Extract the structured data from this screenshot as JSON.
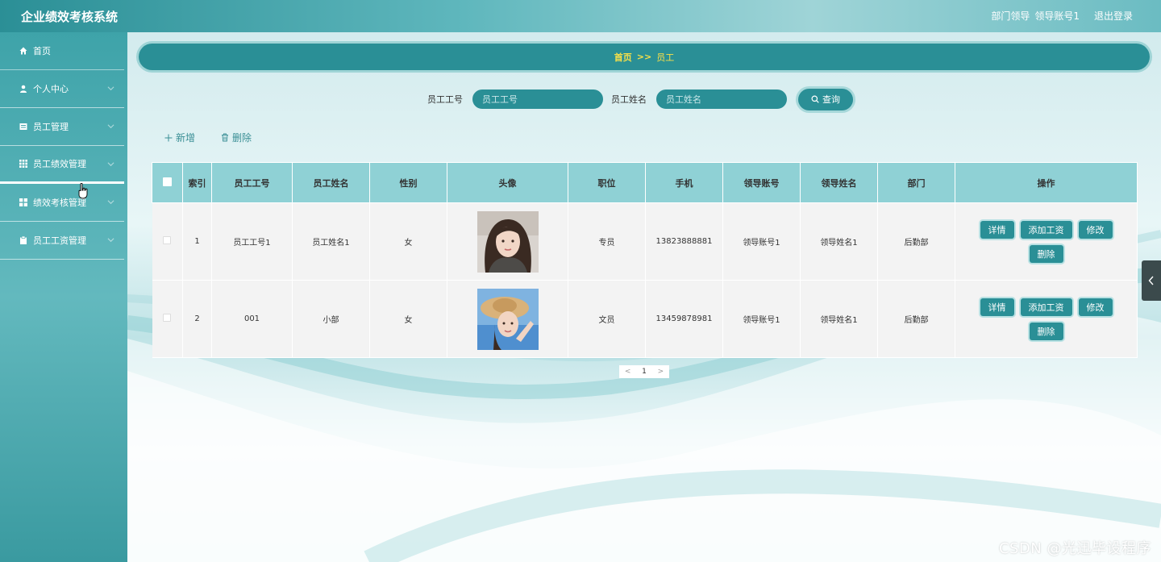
{
  "header": {
    "app_title": "企业绩效考核系统",
    "role": "部门领导",
    "username": "领导账号1",
    "logout": "退出登录"
  },
  "sidebar": {
    "items": [
      {
        "label": "首页",
        "icon": "home-icon"
      },
      {
        "label": "个人中心",
        "icon": "user-icon"
      },
      {
        "label": "员工管理",
        "icon": "list-icon"
      },
      {
        "label": "员工绩效管理",
        "icon": "grid-icon"
      },
      {
        "label": "绩效考核管理",
        "icon": "grid-icon"
      },
      {
        "label": "员工工资管理",
        "icon": "clipboard-icon"
      }
    ]
  },
  "breadcrumb": {
    "home": "首页",
    "separator": ">>",
    "current": "员工"
  },
  "search": {
    "emp_no_label": "员工工号",
    "emp_no_placeholder": "员工工号",
    "emp_name_label": "员工姓名",
    "emp_name_placeholder": "员工姓名",
    "query_label": "查询"
  },
  "actions": {
    "add": "新增",
    "delete": "删除"
  },
  "table": {
    "columns": [
      "索引",
      "员工工号",
      "员工姓名",
      "性别",
      "头像",
      "职位",
      "手机",
      "领导账号",
      "领导姓名",
      "部门",
      "操作"
    ],
    "rows": [
      {
        "index": "1",
        "emp_no": "员工工号1",
        "emp_name": "员工姓名1",
        "gender": "女",
        "position": "专员",
        "phone": "13823888881",
        "leader_account": "领导账号1",
        "leader_name": "领导姓名1",
        "department": "后勤部"
      },
      {
        "index": "2",
        "emp_no": "001",
        "emp_name": "小部",
        "gender": "女",
        "position": "文员",
        "phone": "13459878981",
        "leader_account": "领导账号1",
        "leader_name": "领导姓名1",
        "department": "后勤部"
      }
    ],
    "row_actions": {
      "detail": "详情",
      "add_salary": "添加工资",
      "edit": "修改",
      "delete": "删除"
    }
  },
  "pager": {
    "prev": "<",
    "page": "1",
    "next": ">"
  },
  "watermark": "CSDN @光迅毕设程序",
  "colors": {
    "primary": "#2a8f96",
    "header_row": "#8fd1d5",
    "crumb_text": "#f7e049"
  }
}
